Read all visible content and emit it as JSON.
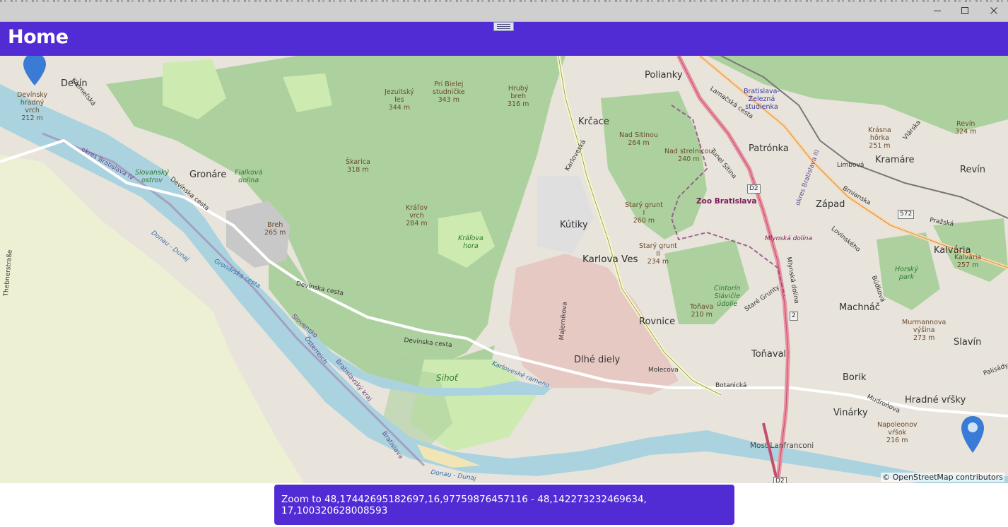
{
  "window": {
    "minimize_icon": "minimize-icon",
    "maximize_icon": "maximize-icon",
    "close_icon": "close-icon"
  },
  "header": {
    "title": "Home",
    "background": "#512bd4",
    "handle_icon": "drag-handle-icon"
  },
  "map": {
    "attribution": "© OpenStreetMap contributors",
    "marker_color": "#3a7bd5",
    "towns": {
      "devin": "Devín",
      "gronare": "Gronáre",
      "karlova_ves": "Karlova Ves",
      "polianky": "Polianky",
      "krcace": "Krčace",
      "patronka": "Patrónka",
      "kramare": "Kramáre",
      "revin": "Revín",
      "zapad": "Západ",
      "kutiky": "Kútiky",
      "kalvaria": "Kalvária",
      "machnac": "Machnáč",
      "rovnice": "Rovnice",
      "slavin": "Slavín",
      "tonaval": "Toňaval",
      "dlhe_diely": "Dlhé diely",
      "borik": "Borik",
      "hradne_vrsky": "Hradné vŕšky",
      "vinarky": "Vinárky",
      "sihot": "Sihoť",
      "most_lanfranconi": "Most Lanfranconi"
    },
    "peaks": {
      "devinsky_hradny_vrch": "Devínsky\nhradný\nvrch\n212 m",
      "jezuitsky_les": "Jezuitský\nles\n344 m",
      "pri_bielej": "Pri Bielej\nstudničke\n343 m",
      "hruby_breh": "Hrubý\nbreh\n316 m",
      "skarica": "Škarica\n318 m",
      "kralov_vrch": "Kráľov\nvrch\n284 m",
      "breh": "Breh\n265 m",
      "nad_sitinou": "Nad Sitinou\n264 m",
      "nad_strelnicou": "Nad strelnicou\n240 m",
      "stary_grunt_1": "Starý grunt\nI\n260 m",
      "stary_grunt_2": "Starý grunt\nII\n234 m",
      "tonava": "Toňava\n210 m",
      "krasna_horka": "Krásna\nhôrka\n251 m",
      "revin_peak": "Revín\n324 m",
      "kalvaria_peak": "Kalvária\n257 m",
      "murmannova": "Murmannova\nvýšina\n273 m",
      "napoleonov": "Napoleonov\nvŕšok\n216 m"
    },
    "areas": {
      "slovensky_ostrov": "Slovanský\nostrov",
      "fialkova_dolina": "Fialková\ndolina",
      "kralova_hora": "Kráľova\nhora",
      "cintorin": "Cintorín\nSlávičie\núdolie",
      "horsky_park": "Horský\npark",
      "mlynska_dolina": "Mlynská dolina",
      "zoo": "Zoo Bratislava",
      "zelezna_studienka": "Bratislava-\nŽelezná\nstudienka"
    },
    "roads": {
      "devinska_cesta_1": "Devínska cesta",
      "devinska_cesta_2": "Devínska cesta",
      "devinska_cesta_3": "Devínska cesta",
      "karlovecka": "Karloveská",
      "lamacska": "Lamačská cesta",
      "molecova": "Molecova",
      "botanicka": "Botanická",
      "majernikova": "Majerníkova",
      "mudronova": "Mudroňova",
      "palisady": "Palisády",
      "prazska": "Pražská",
      "brnianska": "Brnianska",
      "limbova": "Limbová",
      "lovinskeho": "Lovinského",
      "budkova": "Búdková",
      "stare_grunty": "Staré Grunty",
      "mlynska_dolina_road": "Mlynská dolina",
      "karlovesky_rameno": "Karloveské rameno",
      "dunaj_1": "Donau - Dunaj",
      "dunaj_2": "Donau - Dunaj",
      "slovensko_rakusko": "Slovensko",
      "osterreich": "Österreich",
      "bratislava": "Bratislava",
      "bratislavsky_kraj": "Bratislavský kraj",
      "okres_bratislava_iv": "okres Bratislava IV",
      "theben": "Thebnerstraße",
      "kremelska": "Kremeľská",
      "vlarska": "Vlárska",
      "okres_bratislava_iii": "okres Bratislava III",
      "gronarska": "Gronárska cesta",
      "tunel_sitina": "Tunel Sitina"
    },
    "shields": {
      "d2_top": "D2",
      "r572": "572",
      "r2": "2",
      "d2_bottom": "D2"
    }
  },
  "zoom_button": {
    "label": "Zoom to 48,17442695182697,16,97759876457116 - 48,142273232469634, 17,100320628008593"
  }
}
